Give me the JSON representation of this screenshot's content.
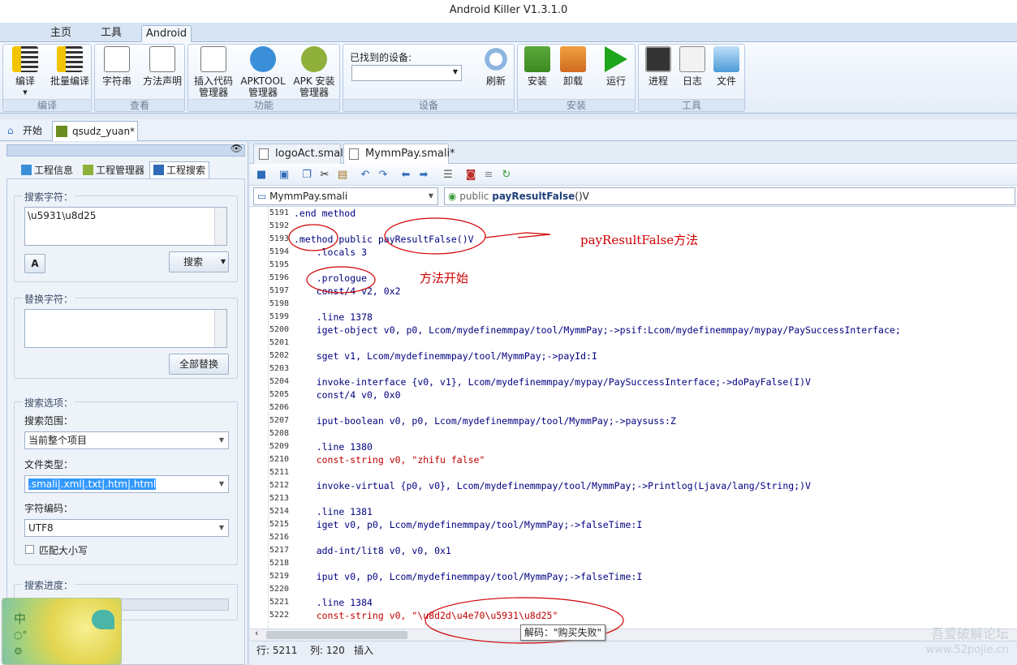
{
  "window": {
    "title": "Android Killer V1.3.1.0"
  },
  "menu_tabs": [
    "主页",
    "工具",
    "Android"
  ],
  "ribbon": {
    "groups": [
      {
        "title": "编译",
        "buttons": [
          "编译",
          "批量编译"
        ]
      },
      {
        "title": "查看",
        "buttons": [
          "字符串",
          "方法声明"
        ]
      },
      {
        "title": "功能",
        "buttons": [
          "插入代码管理器",
          "APKTOOL管理器",
          "APK 安装管理器"
        ]
      },
      {
        "title": "设备",
        "device_label": "已找到的设备:",
        "buttons": [
          "刷新"
        ]
      },
      {
        "title": "安装",
        "buttons": [
          "安装",
          "卸载",
          "运行"
        ]
      },
      {
        "title": "工具",
        "buttons": [
          "进程",
          "日志",
          "文件"
        ]
      }
    ]
  },
  "doc_tabs": [
    "开始",
    "qsudz_yuan*"
  ],
  "left_panel": {
    "tabs": [
      "工程信息",
      "工程管理器",
      "工程搜索"
    ],
    "search_label": "搜索字符：",
    "search_value": "\\u5931\\u8d25",
    "search_button": "搜索",
    "replace_label": "替换字符：",
    "replace_value": "",
    "replace_all_button": "全部替换",
    "options_label": "搜索选项：",
    "scope_label": "搜索范围：",
    "scope_value": "当前整个项目",
    "filetype_label": "文件类型：",
    "filetype_value": ".smali|.xml|.txt|.htm|.html",
    "encoding_label": "字符编码：",
    "encoding_value": "UTF8",
    "match_case_label": "匹配大小写",
    "progress_label": "搜索进度："
  },
  "editor": {
    "tabs": [
      "logoAct.smali",
      "MymmPay.smali*"
    ],
    "file_combo": "MymmPay.smali",
    "method_combo_prefix": "public",
    "method_combo_name": "payResultFalse",
    "method_combo_suffix": "()V",
    "lines": [
      {
        "n": "5191",
        "t": ".end method"
      },
      {
        "n": "5192",
        "t": ""
      },
      {
        "n": "5193",
        "t": ".method public payResultFalse()V"
      },
      {
        "n": "5194",
        "t": "    .locals 3"
      },
      {
        "n": "5195",
        "t": ""
      },
      {
        "n": "5196",
        "t": "    .prologue"
      },
      {
        "n": "5197",
        "t": "    const/4 v2, 0x2"
      },
      {
        "n": "5198",
        "t": ""
      },
      {
        "n": "5199",
        "t": "    .line 1378"
      },
      {
        "n": "5200",
        "t": "    iget-object v0, p0, Lcom/mydefinemmpay/tool/MymmPay;->psif:Lcom/mydefinemmpay/mypay/PaySuccessInterface;"
      },
      {
        "n": "5201",
        "t": ""
      },
      {
        "n": "5202",
        "t": "    sget v1, Lcom/mydefinemmpay/tool/MymmPay;->payId:I"
      },
      {
        "n": "5203",
        "t": ""
      },
      {
        "n": "5204",
        "t": "    invoke-interface {v0, v1}, Lcom/mydefinemmpay/mypay/PaySuccessInterface;->doPayFalse(I)V"
      },
      {
        "n": "5205",
        "t": "    const/4 v0, 0x0"
      },
      {
        "n": "5206",
        "t": ""
      },
      {
        "n": "5207",
        "t": "    iput-boolean v0, p0, Lcom/mydefinemmpay/tool/MymmPay;->paysuss:Z"
      },
      {
        "n": "5208",
        "t": ""
      },
      {
        "n": "5209",
        "t": "    .line 1380"
      },
      {
        "n": "5210",
        "t": "    const-string v0, \"zhifu false\""
      },
      {
        "n": "5211",
        "t": ""
      },
      {
        "n": "5212",
        "t": "    invoke-virtual {p0, v0}, Lcom/mydefinemmpay/tool/MymmPay;->Printlog(Ljava/lang/String;)V"
      },
      {
        "n": "5213",
        "t": ""
      },
      {
        "n": "5214",
        "t": "    .line 1381"
      },
      {
        "n": "5215",
        "t": "    iget v0, p0, Lcom/mydefinemmpay/tool/MymmPay;->falseTime:I"
      },
      {
        "n": "5216",
        "t": ""
      },
      {
        "n": "5217",
        "t": "    add-int/lit8 v0, v0, 0x1"
      },
      {
        "n": "5218",
        "t": ""
      },
      {
        "n": "5219",
        "t": "    iput v0, p0, Lcom/mydefinemmpay/tool/MymmPay;->falseTime:I"
      },
      {
        "n": "5220",
        "t": ""
      },
      {
        "n": "5221",
        "t": "    .line 1384"
      },
      {
        "n": "5222",
        "t": "    const-string v0, \"\\u8d2d\\u4e70\\u5931\\u8d25\""
      }
    ],
    "annotations": {
      "method_note": "payResultFalse方法",
      "prologue_note": "方法开始"
    },
    "tooltip": "解码：\"购买失败\"",
    "status": {
      "row": "行: 5211",
      "col": "列: 120",
      "mode": "插入"
    }
  },
  "watermark": {
    "line1": "吾爱破解论坛",
    "line2": "www.52pojie.cn"
  },
  "widget": {
    "label": "中"
  }
}
